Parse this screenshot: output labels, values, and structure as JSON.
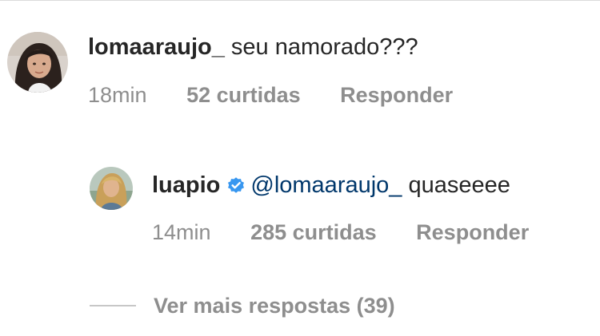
{
  "comment": {
    "username": "lomaaraujo_",
    "text": "seu namorado???",
    "time": "18min",
    "likes": "52 curtidas",
    "reply_label": "Responder",
    "avatar_icon": "profile-photo-lomaaraujo"
  },
  "reply": {
    "username": "luapio",
    "verified": true,
    "mention": "@lomaaraujo_",
    "text": "quaseeee",
    "time": "14min",
    "likes": "285 curtidas",
    "reply_label": "Responder",
    "avatar_icon": "profile-photo-luapio"
  },
  "view_more": {
    "label": "Ver mais respostas (39)"
  },
  "colors": {
    "text": "#262626",
    "secondary": "#8e8e8e",
    "mention": "#00376b",
    "verified": "#3897f0"
  }
}
